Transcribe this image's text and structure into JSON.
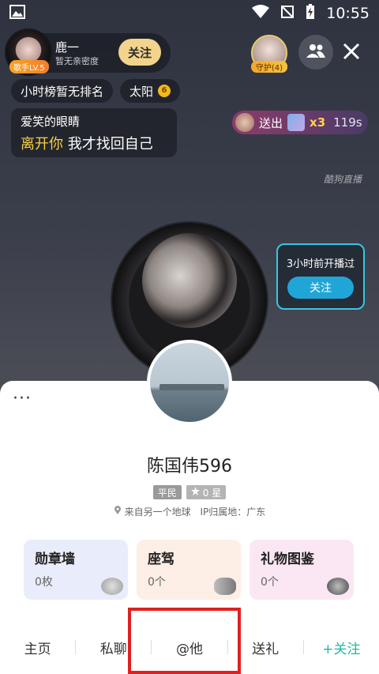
{
  "status_bar": {
    "time": "10:55"
  },
  "host": {
    "name": "鹿一",
    "subtitle": "暂无亲密度",
    "level_badge": "歌手LV.5",
    "follow_label": "关注"
  },
  "guard": {
    "label": "守护(4)"
  },
  "tags": {
    "rank": "小时榜暂无排名",
    "sun": "太阳"
  },
  "song": {
    "title": "爱笑的眼睛",
    "lyric_highlight": "离开你",
    "lyric_rest": " 我才找回自己"
  },
  "gift": {
    "action": "送出",
    "multiplier": "x3",
    "countdown": "119s"
  },
  "watermark": "酷狗直播",
  "replay": {
    "text": "3小时前开播过",
    "button": "关注"
  },
  "profile": {
    "name": "陈国伟596",
    "rank": "平民",
    "stars": "0 星",
    "location": "来自另一个地球",
    "ip_region": "IP归属地：广东"
  },
  "cards": [
    {
      "title": "勋章墙",
      "count": "0枚"
    },
    {
      "title": "座驾",
      "count": "0个"
    },
    {
      "title": "礼物图鉴",
      "count": "0个"
    }
  ],
  "nav": {
    "home": "主页",
    "private_chat": "私聊",
    "mention": "@他",
    "send_gift": "送礼",
    "follow": "+关注"
  },
  "colors": {
    "accent_follow": "#1fb8a6",
    "highlight_border": "#e02020",
    "follow_pill": "#f2d48c"
  }
}
